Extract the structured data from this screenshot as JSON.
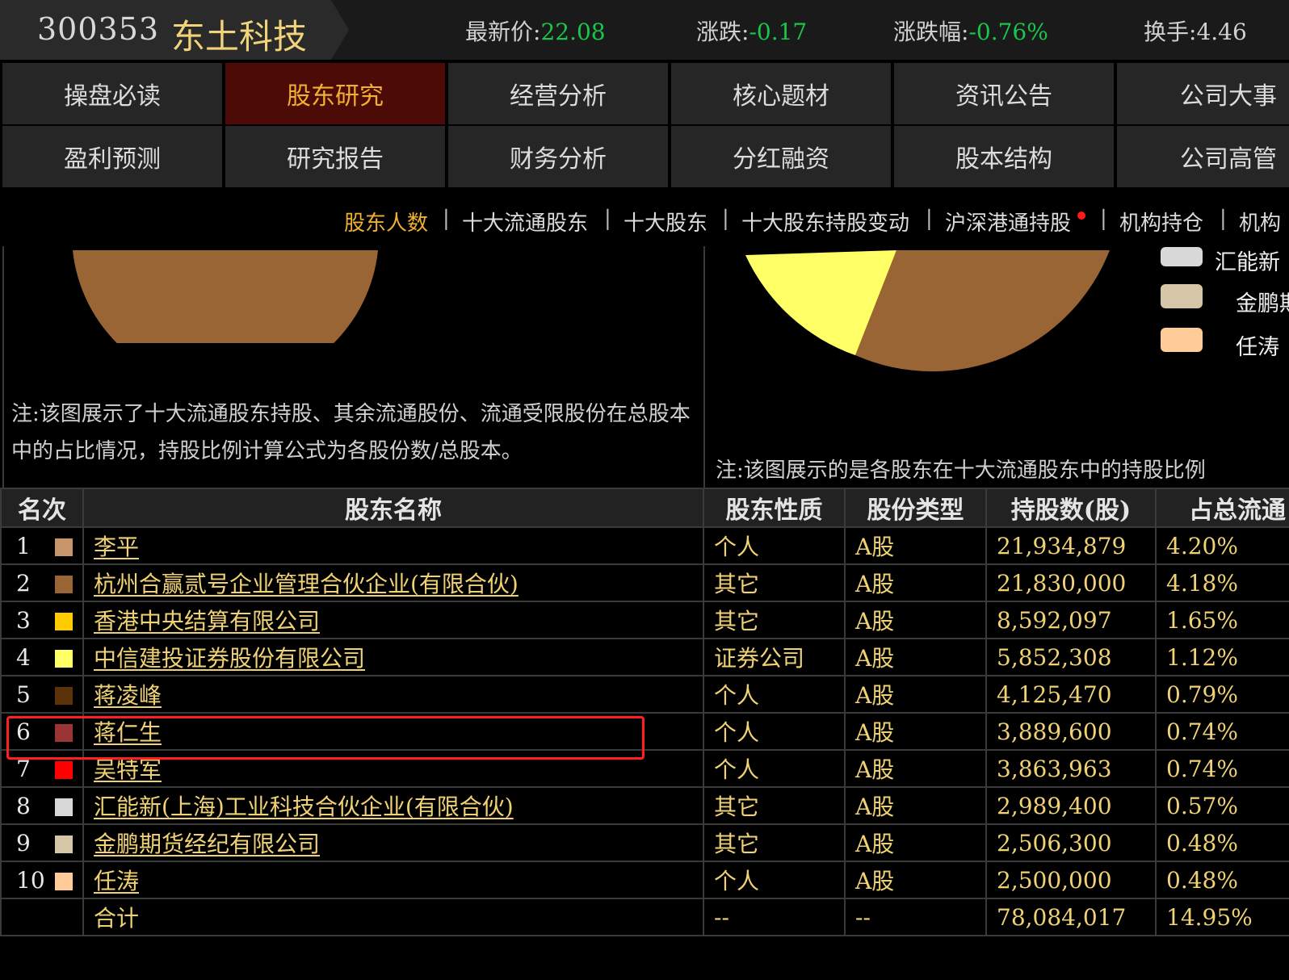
{
  "header": {
    "stock_code": "300353",
    "stock_name": "东土科技",
    "latest_price_label": "最新价:",
    "latest_price": "22.08",
    "change_label": "涨跌:",
    "change": "-0.17",
    "change_pct_label": "涨跌幅:",
    "change_pct": "-0.76%",
    "turnover_label": "换手:",
    "turnover": "4.46",
    "down_color": "#18c64a"
  },
  "nav": {
    "row1": [
      "操盘必读",
      "股东研究",
      "经营分析",
      "核心题材",
      "资讯公告",
      "公司大事"
    ],
    "row2": [
      "盈利预测",
      "研究报告",
      "财务分析",
      "分红融资",
      "股本结构",
      "公司高管"
    ],
    "active": "股东研究"
  },
  "subnav": {
    "items": [
      "股东人数",
      "十大流通股东",
      "十大股东",
      "十大股东持股变动",
      "沪深港通持股",
      "机构持仓",
      "机构"
    ],
    "separator": "|",
    "active": "股东人数"
  },
  "left_panel": {
    "note": "注:该图展示了十大流通股东持股、其余流通股份、流通受限股份在总股本中的占比情况，持股比例计算公式为各股份数/总股本。"
  },
  "right_panel": {
    "note": "注:该图展示的是各股东在十大流通股东中的持股比例",
    "legend": [
      {
        "label": "汇能新",
        "color": "#d8d8d8"
      },
      {
        "label": "金鹏期",
        "color": "#d6c6a8"
      },
      {
        "label": "任涛",
        "color": "#ffcc99"
      }
    ]
  },
  "table": {
    "headers": [
      "名次",
      "股东名称",
      "股东性质",
      "股份类型",
      "持股数(股)",
      "占总流通"
    ],
    "rows": [
      {
        "rank": "1",
        "color": "#c8956a",
        "name": "李平",
        "nature": "个人",
        "type": "A股",
        "shares": "21,934,879",
        "pct": "4.20%"
      },
      {
        "rank": "2",
        "color": "#9a6535",
        "name": "杭州合赢贰号企业管理合伙企业(有限合伙)",
        "nature": "其它",
        "type": "A股",
        "shares": "21,830,000",
        "pct": "4.18%"
      },
      {
        "rank": "3",
        "color": "#ffcc00",
        "name": "香港中央结算有限公司",
        "nature": "其它",
        "type": "A股",
        "shares": "8,592,097",
        "pct": "1.65%"
      },
      {
        "rank": "4",
        "color": "#ffff66",
        "name": "中信建投证券股份有限公司",
        "nature": "证券公司",
        "type": "A股",
        "shares": "5,852,308",
        "pct": "1.12%"
      },
      {
        "rank": "5",
        "color": "#5c3208",
        "name": "蒋凌峰",
        "nature": "个人",
        "type": "A股",
        "shares": "4,125,470",
        "pct": "0.79%"
      },
      {
        "rank": "6",
        "color": "#9b3535",
        "name": "蒋仁生",
        "nature": "个人",
        "type": "A股",
        "shares": "3,889,600",
        "pct": "0.74%"
      },
      {
        "rank": "7",
        "color": "#ff0000",
        "name": "吴特军",
        "nature": "个人",
        "type": "A股",
        "shares": "3,863,963",
        "pct": "0.74%"
      },
      {
        "rank": "8",
        "color": "#d8d8d8",
        "name": "汇能新(上海)工业科技合伙企业(有限合伙)",
        "nature": "其它",
        "type": "A股",
        "shares": "2,989,400",
        "pct": "0.57%"
      },
      {
        "rank": "9",
        "color": "#d6c6a8",
        "name": "金鹏期货经纪有限公司",
        "nature": "其它",
        "type": "A股",
        "shares": "2,506,300",
        "pct": "0.48%"
      },
      {
        "rank": "10",
        "color": "#ffcc99",
        "name": "任涛",
        "nature": "个人",
        "type": "A股",
        "shares": "2,500,000",
        "pct": "0.48%"
      }
    ],
    "total": {
      "label": "合计",
      "nature": "--",
      "type": "--",
      "shares": "78,084,017",
      "pct": "14.95%"
    }
  }
}
